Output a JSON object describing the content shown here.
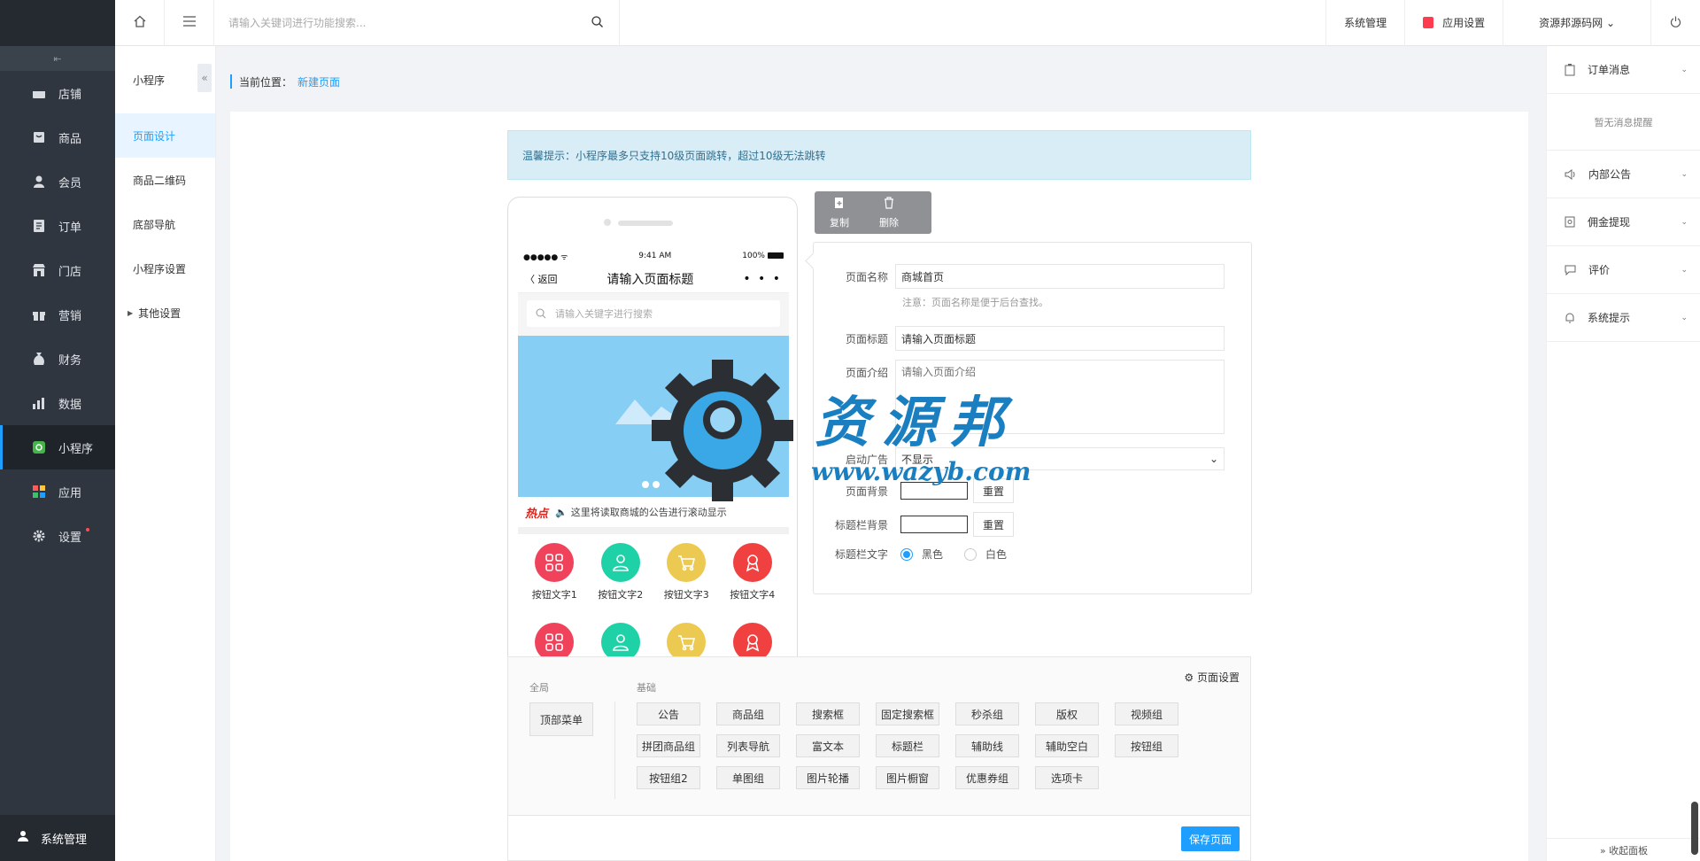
{
  "topbar": {
    "search_placeholder": "请输入关键词进行功能搜索...",
    "links": [
      "系统管理",
      "应用设置",
      "资源邦源码网 ⌄"
    ]
  },
  "sidebar": {
    "items": [
      {
        "label": "店铺",
        "icon": "store-icon"
      },
      {
        "label": "商品",
        "icon": "goods-icon"
      },
      {
        "label": "会员",
        "icon": "user-icon"
      },
      {
        "label": "订单",
        "icon": "order-icon"
      },
      {
        "label": "门店",
        "icon": "shop-icon"
      },
      {
        "label": "营销",
        "icon": "gift-icon"
      },
      {
        "label": "财务",
        "icon": "money-bag-icon"
      },
      {
        "label": "数据",
        "icon": "chart-icon"
      },
      {
        "label": "小程序",
        "icon": "miniapp-icon"
      },
      {
        "label": "应用",
        "icon": "apps-icon"
      },
      {
        "label": "设置",
        "icon": "gear-icon"
      }
    ],
    "bottom": "系统管理"
  },
  "submenu": {
    "title": "小程序",
    "items": [
      "页面设计",
      "商品二维码",
      "底部导航",
      "小程序设置",
      "其他设置"
    ]
  },
  "breadcrumb": {
    "prefix": "当前位置：",
    "current": "新建页面"
  },
  "tip": "温馨提示：小程序最多只支持10级页面跳转，超过10级无法跳转",
  "phone": {
    "signal": "●●●●● ᯤ",
    "time": "9:41 AM",
    "battery": "100%",
    "back": "〈 返回",
    "title": "请输入页面标题",
    "more": "• • •",
    "search_placeholder": "请输入关键字进行搜索",
    "hot": "热点",
    "notice": "这里将读取商城的公告进行滚动显示",
    "buttons": [
      "按钮文字1",
      "按钮文字2",
      "按钮文字3",
      "按钮文字4"
    ],
    "button_colors": [
      "#f0435b",
      "#1fd1a7",
      "#ecc950",
      "#f04040"
    ]
  },
  "actions": {
    "copy": "复制",
    "delete": "删除"
  },
  "form": {
    "name_label": "页面名称",
    "name_value": "商城首页",
    "name_hint": "注意：页面名称是便于后台查找。",
    "title_label": "页面标题",
    "title_value": "请输入页面标题",
    "intro_label": "页面介绍",
    "intro_placeholder": "请输入页面介绍",
    "ad_label": "启动广告",
    "ad_value": "不显示",
    "bg_label": "页面背景",
    "bar_bg_label": "标题栏背景",
    "reset": "重置",
    "bar_text_label": "标题栏文字",
    "opt_black": "黑色",
    "opt_white": "白色"
  },
  "components": {
    "page_settings": "⚙ 页面设置",
    "global_label": "全局",
    "basic_label": "基础",
    "top_menu": "顶部菜单",
    "items": [
      "公告",
      "商品组",
      "搜索框",
      "固定搜索框",
      "秒杀组",
      "版权",
      "视频组",
      "拼团商品组",
      "列表导航",
      "富文本",
      "标题栏",
      "辅助线",
      "辅助空白",
      "按钮组",
      "按钮组2",
      "单图组",
      "图片轮播",
      "图片橱窗",
      "优惠券组",
      "选项卡"
    ],
    "save": "保存页面"
  },
  "rpanel": {
    "order": "订单消息",
    "empty": "暂无消息提醒",
    "items": [
      "内部公告",
      "佣金提现",
      "评价",
      "系统提示"
    ],
    "fold": "» 收起面板"
  },
  "watermark": {
    "cn": "资源邦",
    "url": "www.wazyb.com"
  },
  "colors": {
    "accent": "#1e9fff",
    "sidebar": "#2f3640"
  }
}
